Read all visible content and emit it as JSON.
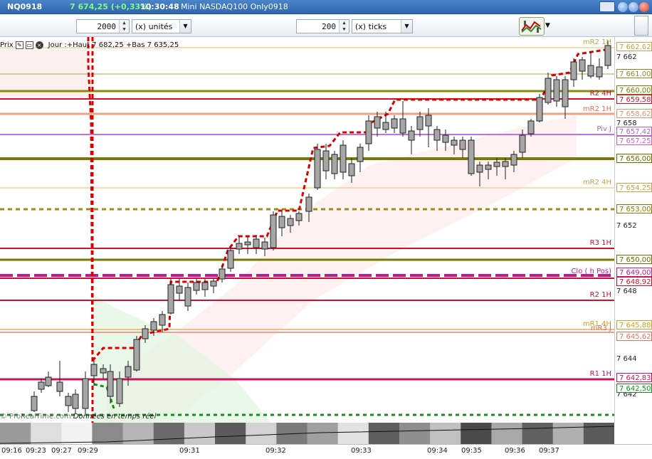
{
  "window": {
    "symbol": "NQ0918",
    "last_change": "7 674,25 (+0,33%)",
    "clock": "10:30:48",
    "instrument_name": "Mini NASDAQ100 Only0918"
  },
  "toolbar": {
    "units_value": "2000",
    "units_label": "(x) unités",
    "ticks_value": "200",
    "ticks_label": "(x) ticks"
  },
  "chart_header": {
    "price_label": "Prix",
    "stats": "Jour :+Haut 7 682,25 +Bas 7 635,25"
  },
  "level_labels": {
    "mr2_top": "mR2 1H",
    "r2_4h": "R2 4H",
    "mr2_1": "mR2 1H",
    "piv_j": "Piv J",
    "mr2_4h": "mR2 4H",
    "r3_1h": "R3 1H",
    "clo": "Clo ( h Pos)",
    "r2_1h": "R2 1H",
    "mr1_4h": "mR1 4H",
    "mr3_j": "mR3 J",
    "r1_1h": "R1 1H"
  },
  "axis_badges": [
    {
      "text": "7 662,62",
      "color": "#c8a24a"
    },
    {
      "text": "7 661,00",
      "color": "#8a8a2a"
    },
    {
      "text": "7 660,00",
      "color": "#7a7a10"
    },
    {
      "text": "7 659,58",
      "color": "#d0102a"
    },
    {
      "text": "7 658,62",
      "color": "#e89070"
    },
    {
      "text": "7 657,42",
      "color": "#b060d0"
    },
    {
      "text": "7 657,25",
      "color": "#d060c0"
    },
    {
      "text": "7 656,00",
      "color": "#6a6a00"
    },
    {
      "text": "7 654,25",
      "color": "#c8a24a"
    },
    {
      "text": "7 653,00",
      "color": "#8a7a00"
    },
    {
      "text": "7 650,00",
      "color": "#6a6a00"
    },
    {
      "text": "7 649,00",
      "color": "#c01890"
    },
    {
      "text": "7 648,92",
      "color": "#d0102a"
    },
    {
      "text": "7 645,88",
      "color": "#d0a020"
    },
    {
      "text": "7 645,62",
      "color": "#e87060"
    },
    {
      "text": "7 642,83",
      "color": "#d01060"
    },
    {
      "text": "7 642,50",
      "color": "#10901a"
    }
  ],
  "axis_ticks": [
    "7 662",
    "7 658",
    "7 652",
    "7 648",
    "7 644",
    "7 642"
  ],
  "time_labels": [
    "09:16",
    "09:23",
    "09:27",
    "09:29",
    "09:31",
    "09:32",
    "09:33",
    "09:34",
    "09:35",
    "09:36",
    "09:37"
  ],
  "watermark": {
    "copyright": "© ProRealTime.com",
    "realtime": "Données en temps réel"
  },
  "colors": {
    "title_bg": "#3a74bd",
    "up_green": "#7dff7d",
    "candle": "#a6a6a6",
    "resistance_red": "#d0102a",
    "olive": "#8a8a10",
    "pivot_violet": "#c070e0",
    "trail_red": "#d80000",
    "support_green": "#10901a"
  },
  "icons": [
    "keyboard-icon",
    "minimize-icon",
    "maximize-icon",
    "close-icon",
    "wrench-icon",
    "window-icon",
    "close-circle-icon",
    "chart-tool-icon"
  ]
}
